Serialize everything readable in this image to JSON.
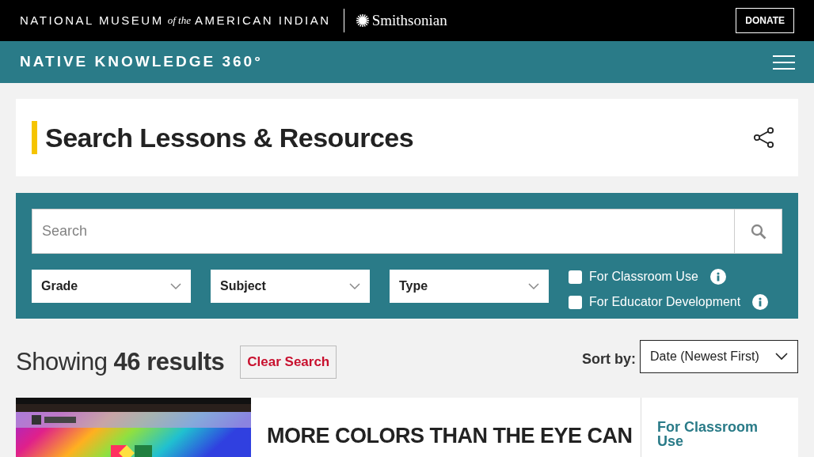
{
  "header": {
    "museum_prefix": "NATIONAL MUSEUM",
    "museum_of": "of the",
    "museum_suffix": "AMERICAN INDIAN",
    "partner": "Smithsonian",
    "donate": "DONATE"
  },
  "nav": {
    "site_title": "NATIVE KNOWLEDGE 360°"
  },
  "page_title": "Search Lessons & Resources",
  "search": {
    "placeholder": "Search"
  },
  "filters": [
    {
      "label": "Grade"
    },
    {
      "label": "Subject"
    },
    {
      "label": "Type"
    }
  ],
  "checkboxes": [
    {
      "label": "For Classroom Use",
      "checked": false
    },
    {
      "label": "For Educator Development",
      "checked": false
    }
  ],
  "results": {
    "prefix": "Showing",
    "count": "46 results",
    "clear": "Clear Search"
  },
  "sort": {
    "label": "Sort by:",
    "value": "Date (Newest First)"
  },
  "cards": [
    {
      "title": "MORE COLORS THAN THE EYE CAN",
      "audience": "For Classroom Use"
    }
  ]
}
